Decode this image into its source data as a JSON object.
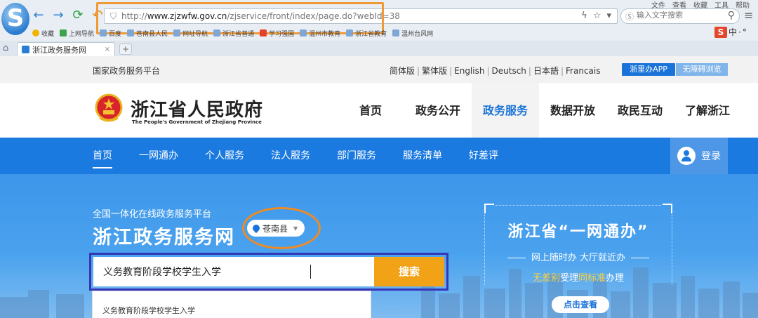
{
  "browser": {
    "system_menu": [
      "文件",
      "查看",
      "收藏",
      "工具",
      "帮助"
    ],
    "logo_letter": "S",
    "address": {
      "prefix": "http://",
      "domain": "www.zjzwfw.gov.cn",
      "path": "/zjservice/front/index/page.do?webId=38"
    },
    "search_placeholder": "输入文字搜索",
    "bookmarks": [
      "收藏",
      "上网导航",
      "百度",
      "苍南县人民",
      "网址导航",
      "浙江省普通",
      "学习强国",
      "温州市教育",
      "浙江省教育",
      "温州台风网"
    ],
    "ime": [
      "中",
      "·",
      "°"
    ],
    "tab_title": "浙江政务服务网",
    "new_tab": "+"
  },
  "topbar": {
    "platform": "国家政务服务平台",
    "languages": [
      "简体版",
      "繁体版",
      "English",
      "Deutsch",
      "日本語",
      "Francais"
    ],
    "app_button": "浙里办APP",
    "accessible_button": "无障碍浏览"
  },
  "header": {
    "name_cn": "浙江省人民政府",
    "name_en": "The People's Government of Zhejiang Province",
    "nav": [
      "首页",
      "政务公开",
      "政务服务",
      "数据开放",
      "政民互动",
      "了解浙江"
    ],
    "active_nav": "政务服务"
  },
  "subnav": {
    "items": [
      "首页",
      "一网通办",
      "个人服务",
      "法人服务",
      "部门服务",
      "服务清单",
      "好差评"
    ],
    "login": "登录"
  },
  "hero": {
    "subtitle": "全国一体化在线政务服务平台",
    "title": "浙江政务服务网",
    "region": "苍南县",
    "search_value": "义务教育阶段学校学生入学",
    "search_button": "搜索",
    "suggestion": "义务教育阶段学校学生入学"
  },
  "promo": {
    "title": "浙江省“一网通办”",
    "line1": "网上随时办 大厅就近办",
    "line2_a": "无差别",
    "line2_b": "受理",
    "line2_c": "同标准",
    "line2_d": "办理",
    "button": "点击查看"
  },
  "colors": {
    "brand_blue": "#1b7ae0",
    "search_orange": "#f2a217",
    "annotation_orange": "#f09a37",
    "annotation_purple": "#3437b8"
  }
}
